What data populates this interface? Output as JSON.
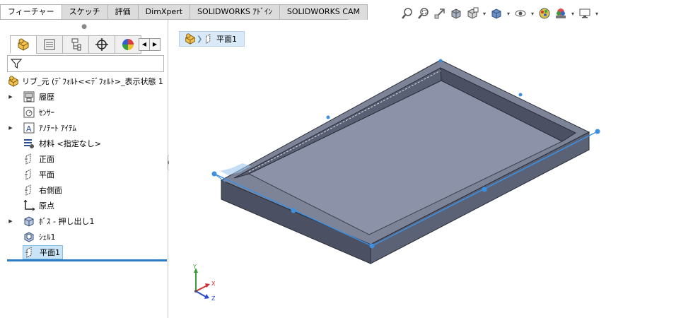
{
  "top_tabs": [
    {
      "label": "フィーチャー",
      "active": true
    },
    {
      "label": "スケッチ"
    },
    {
      "label": "評価"
    },
    {
      "label": "DimXpert"
    },
    {
      "label": "SOLIDWORKS ｱﾄﾞｲﾝ"
    },
    {
      "label": "SOLIDWORKS CAM"
    }
  ],
  "view_toolbar": {
    "icons": [
      "zoom-to-fit-icon",
      "zoom-to-area-icon",
      "previous-view-icon",
      "section-view-icon",
      "view-orientation-icon",
      "display-style-icon",
      "hide-show-icon",
      "edit-appearance-icon",
      "apply-scene-icon",
      "view-settings-icon"
    ]
  },
  "manager_tabs": [
    "featuremanager-icon",
    "propertymanager-icon",
    "configurationmanager-icon",
    "dimxpert-icon",
    "display-manager-icon"
  ],
  "tree": {
    "root_label": "リブ_元  (ﾃﾞﾌｫﾙﾄ<<ﾃﾞﾌｫﾙﾄ>_表示状態 1",
    "items": [
      {
        "label": "履歴",
        "icon": "history-icon",
        "expandable": true
      },
      {
        "label": "ｾﾝｻｰ",
        "icon": "sensor-icon",
        "expandable": false
      },
      {
        "label": "ｱﾉﾃｰﾄ ｱｲﾃﾑ",
        "icon": "annotation-icon",
        "expandable": true
      },
      {
        "label": "材料 <指定なし>",
        "icon": "material-icon",
        "expandable": false
      },
      {
        "label": "正面",
        "icon": "plane-icon",
        "expandable": false
      },
      {
        "label": "平面",
        "icon": "plane-icon",
        "expandable": false
      },
      {
        "label": "右側面",
        "icon": "plane-icon",
        "expandable": false
      },
      {
        "label": "原点",
        "icon": "origin-icon",
        "expandable": false
      },
      {
        "label": "ﾎﾞｽ - 押し出し1",
        "icon": "extrude-icon",
        "expandable": true
      },
      {
        "label": "ｼｪﾙ1",
        "icon": "shell-icon",
        "expandable": false
      },
      {
        "label": "平面1",
        "icon": "plane-icon",
        "expandable": false,
        "selected": true
      }
    ]
  },
  "breadcrumb": {
    "label": "平面1"
  },
  "triad": {
    "x_label": "X",
    "y_label": "Y",
    "z_label": "Z"
  },
  "colors": {
    "selection_blue": "#3d8fe0",
    "selected_row": "#c9e4f7",
    "tree_end_bar": "#2b7ac2",
    "model_side": "#4b5163",
    "model_floor": "#8c93a8"
  }
}
